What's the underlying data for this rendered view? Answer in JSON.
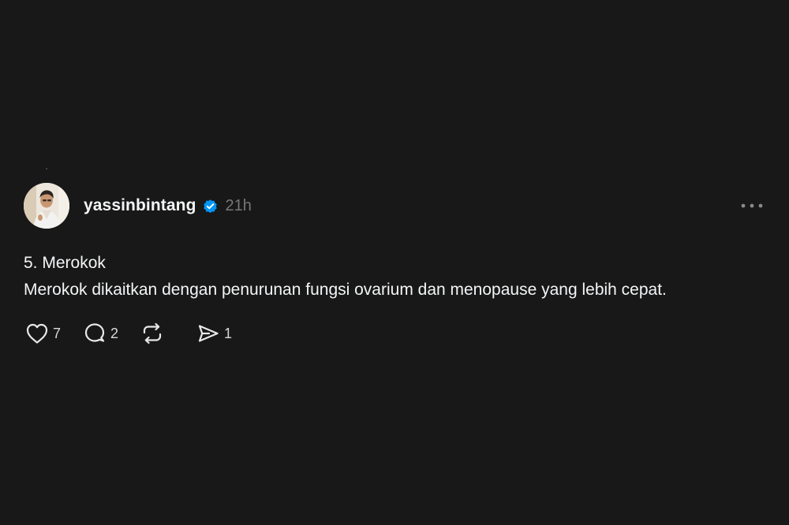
{
  "post": {
    "author": {
      "username": "yassinbintang",
      "verified": true,
      "avatar_icon": "profile-photo"
    },
    "timestamp": "21h",
    "more_icon": "more-horizontal-icon",
    "content": {
      "line1": "5. Merokok",
      "line2": "Merokok dikaitkan dengan penurunan fungsi ovarium dan menopause yang lebih cepat."
    },
    "actions": {
      "like": {
        "icon": "heart-icon",
        "count": "7"
      },
      "reply": {
        "icon": "comment-icon",
        "count": "2"
      },
      "repost": {
        "icon": "repost-icon",
        "count": ""
      },
      "share": {
        "icon": "send-icon",
        "count": "1"
      }
    }
  },
  "colors": {
    "background": "#181818",
    "text_primary": "#f3f5f7",
    "text_secondary": "#777777",
    "verified_badge": "#0095f6"
  }
}
